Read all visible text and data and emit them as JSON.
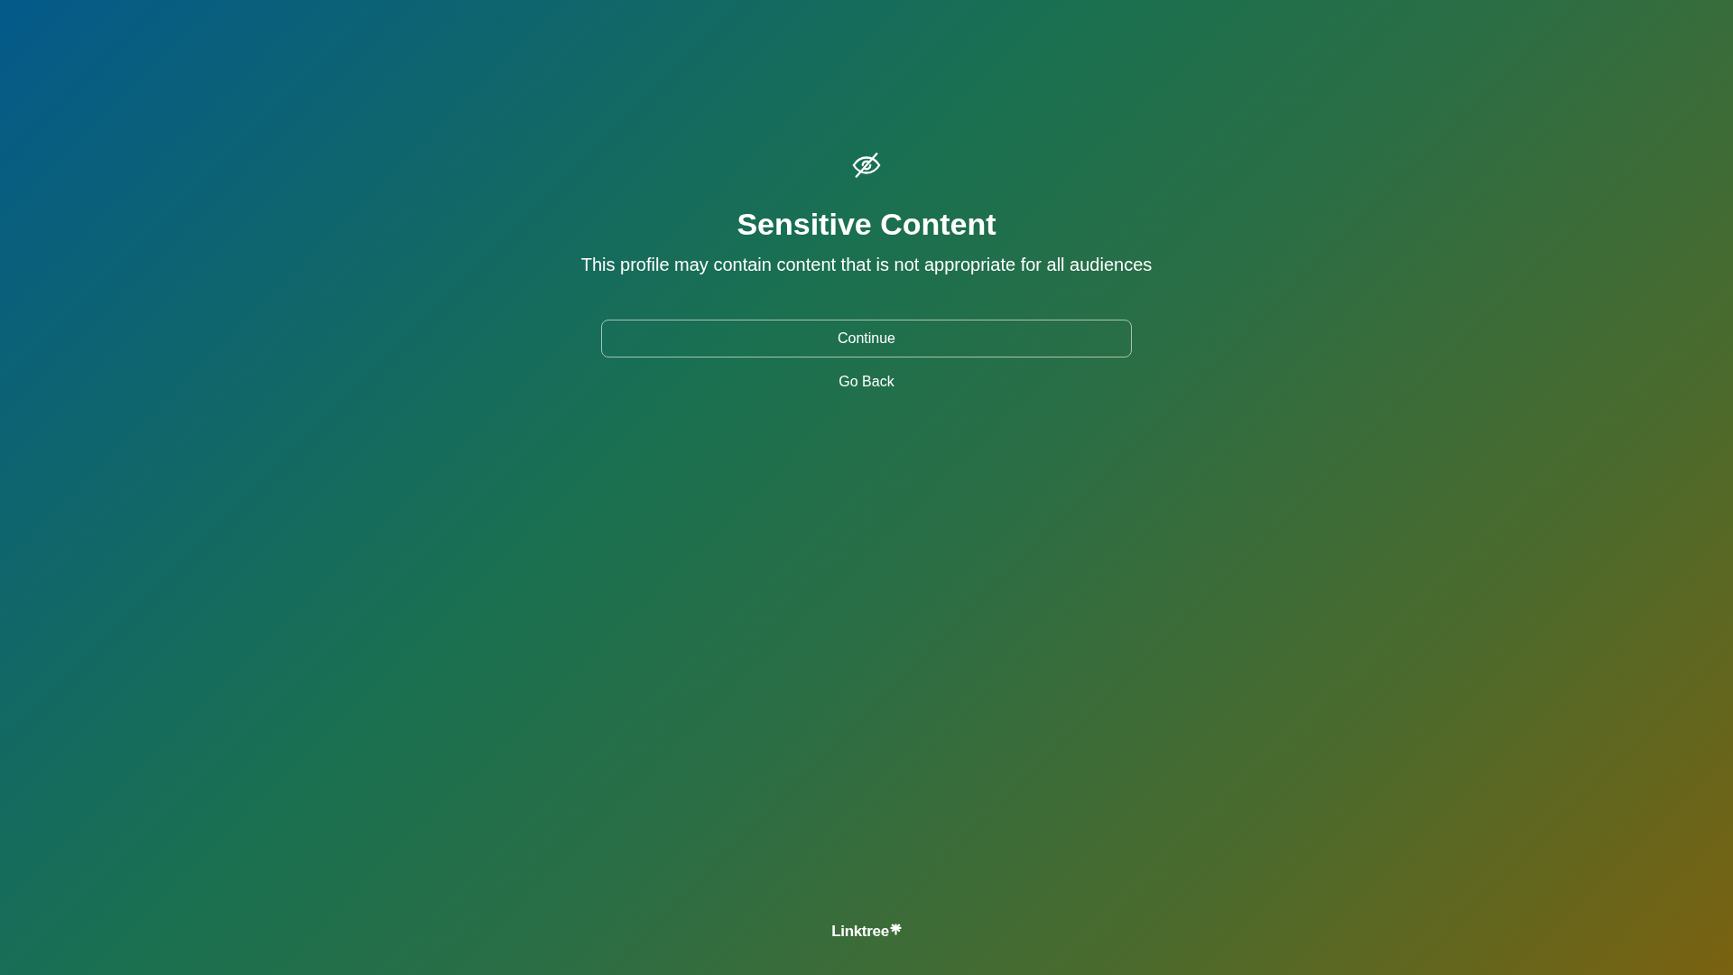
{
  "title": "Sensitive Content",
  "message": "This profile may contain content that is not appropriate for all audiences",
  "buttons": [
    {
      "label": "Continue",
      "kind": "outlined"
    },
    {
      "label": "Go Back",
      "kind": "text"
    }
  ],
  "footer": {
    "brand": "Linktree"
  }
}
